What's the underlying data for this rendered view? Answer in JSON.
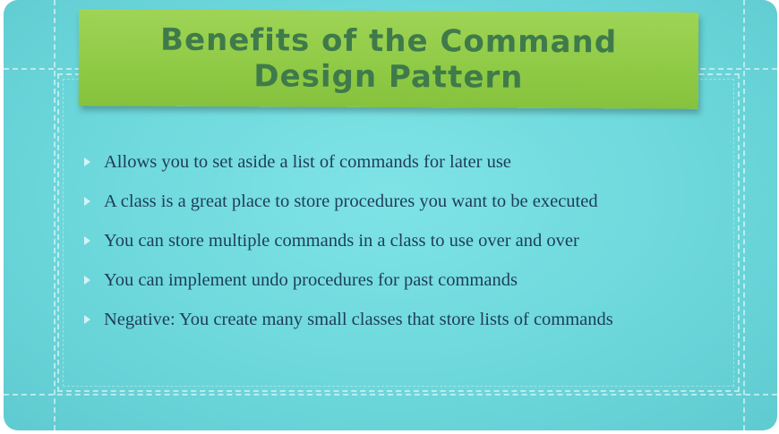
{
  "slide": {
    "title": "Benefits of the Command Design Pattern",
    "bullets": [
      "Allows you to set aside a list of commands for later use",
      "A class is a great place to store procedures you want to be executed",
      "You can store multiple commands in a class to use over and over",
      "You can implement undo procedures for past commands",
      "Negative: You create many small classes that store lists of commands"
    ]
  },
  "colors": {
    "background": "#6dd8dc",
    "banner": "#8fca45",
    "title_text": "#3f7a4b",
    "body_text": "#1e3d5a"
  }
}
